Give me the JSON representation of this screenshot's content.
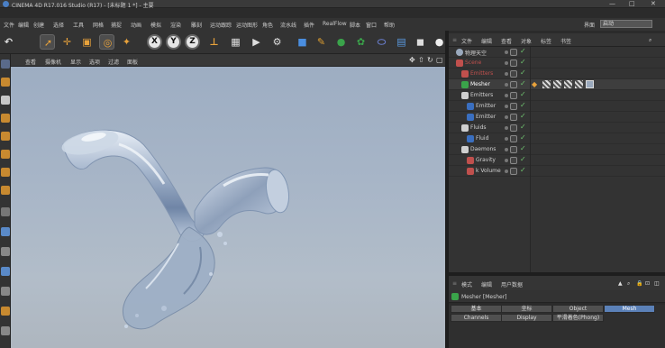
{
  "window": {
    "title": "CINEMA 4D R17.016 Studio (R17) - [未标题 1 *] - 主要",
    "controls": [
      "—",
      "□",
      "✕"
    ]
  },
  "menubar": {
    "items": [
      "文件",
      "编辑",
      "创建",
      "选择",
      "工具",
      "网格",
      "捕捉",
      "动画",
      "模拟",
      "渲染",
      "雕刻",
      "运动跟踪",
      "运动图形",
      "角色",
      "流水线",
      "插件",
      "RealFlow",
      "脚本",
      "窗口",
      "帮助"
    ],
    "layout_label": "界面",
    "layout_value": "启动"
  },
  "toolbar": {
    "axes": [
      "X",
      "Y",
      "Z"
    ]
  },
  "viewport": {
    "menu": [
      "查看",
      "摄像机",
      "显示",
      "选项",
      "过滤",
      "面板"
    ],
    "nav_icons": [
      "✥",
      "⇧",
      "↻",
      "▢"
    ]
  },
  "object_manager": {
    "tabs": [
      "文件",
      "编辑",
      "查看",
      "对象",
      "标签",
      "书签"
    ],
    "objects": [
      {
        "name": "物理天空",
        "color": "#9aa9bd"
      },
      {
        "name": "Scene",
        "color": "#c0504d"
      },
      {
        "name": "Emitters",
        "color": "#c0504d"
      },
      {
        "name": "Mesher",
        "color": "#3aa34a"
      },
      {
        "name": "Emitters",
        "color": "#cfcfcf"
      },
      {
        "name": "Emitter",
        "color": "#3a6fc0"
      },
      {
        "name": "Emitter",
        "color": "#3a6fc0"
      },
      {
        "name": "Fluids",
        "color": "#cfcfcf"
      },
      {
        "name": "Fluid",
        "color": "#3a6fc0"
      },
      {
        "name": "Daemons",
        "color": "#cfcfcf"
      },
      {
        "name": "Gravity",
        "color": "#c0504d"
      },
      {
        "name": "k Volume",
        "color": "#c0504d"
      }
    ]
  },
  "attribute_manager": {
    "tabs": [
      "模式",
      "编辑",
      "用户数据"
    ],
    "object_title": "Mesher [Mesher]",
    "tabs_row1": [
      "基本",
      "坐标",
      "Object",
      "Mesh"
    ],
    "tabs_row2": [
      "Channels",
      "Display",
      "平滑着色(Phong)"
    ]
  }
}
